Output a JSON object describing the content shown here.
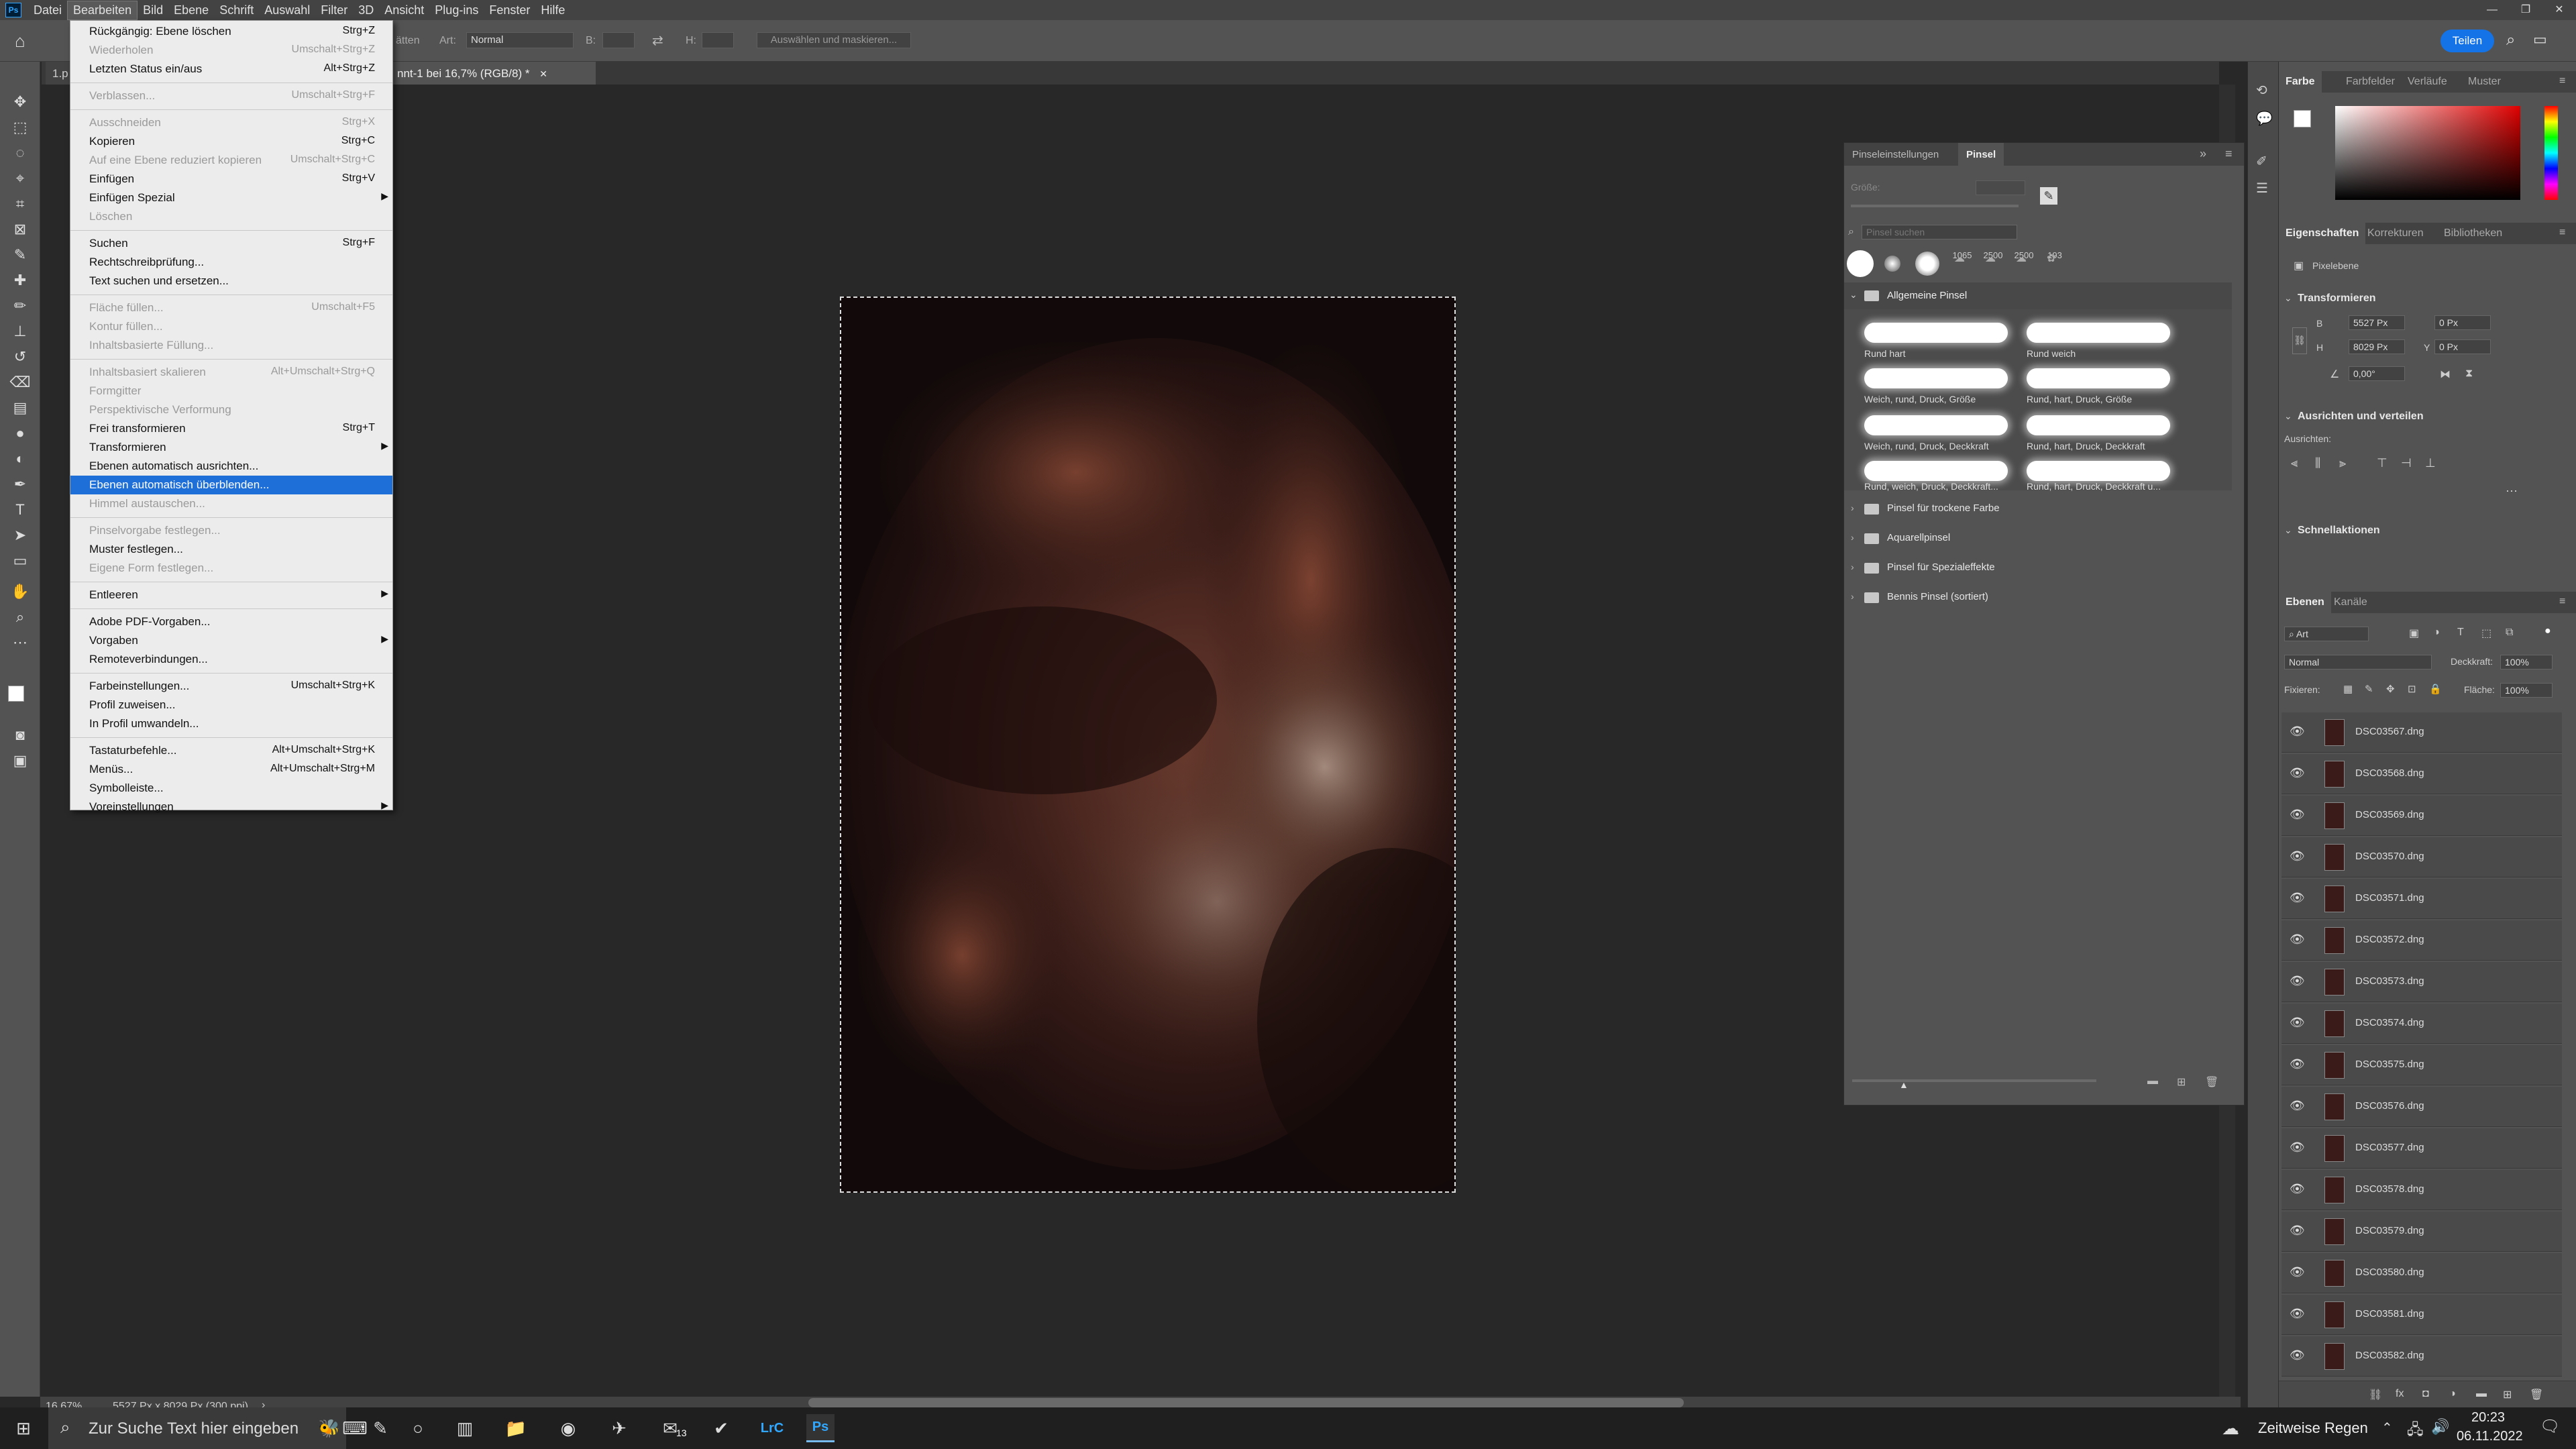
{
  "app": {
    "logo": "Ps"
  },
  "menubar": [
    "Datei",
    "Bearbeiten",
    "Bild",
    "Ebene",
    "Schrift",
    "Auswahl",
    "Filter",
    "3D",
    "Ansicht",
    "Plug-ins",
    "Fenster",
    "Hilfe"
  ],
  "window_controls": [
    "—",
    "❐",
    "✕"
  ],
  "options": {
    "art_label": "Art:",
    "art_value": "Normal",
    "b_label": "B:",
    "h_label": "H:",
    "select_mask": "Auswählen und maskieren...",
    "share": "Teilen",
    "faded_label": "ätten"
  },
  "tabs": [
    {
      "label": "1.p"
    },
    {
      "label": "nnt-1 bei 16,7% (RGB/8) *"
    }
  ],
  "edit_menu": [
    {
      "label": "Rückgängig: Ebene löschen",
      "shortcut": "Strg+Z",
      "disabled": false
    },
    {
      "label": "Wiederholen",
      "shortcut": "Umschalt+Strg+Z",
      "disabled": true
    },
    {
      "label": "Letzten Status ein/aus",
      "shortcut": "Alt+Strg+Z",
      "disabled": false
    },
    {
      "sep": true
    },
    {
      "label": "Verblassen...",
      "shortcut": "Umschalt+Strg+F",
      "disabled": true
    },
    {
      "sep": true
    },
    {
      "label": "Ausschneiden",
      "shortcut": "Strg+X",
      "disabled": true
    },
    {
      "label": "Kopieren",
      "shortcut": "Strg+C",
      "disabled": false
    },
    {
      "label": "Auf eine Ebene reduziert kopieren",
      "shortcut": "Umschalt+Strg+C",
      "disabled": true
    },
    {
      "label": "Einfügen",
      "shortcut": "Strg+V",
      "disabled": false
    },
    {
      "label": "Einfügen Spezial",
      "shortcut": "",
      "submenu": true,
      "disabled": false
    },
    {
      "label": "Löschen",
      "shortcut": "",
      "disabled": true
    },
    {
      "sep": true
    },
    {
      "label": "Suchen",
      "shortcut": "Strg+F",
      "disabled": false
    },
    {
      "label": "Rechtschreibprüfung...",
      "shortcut": "",
      "disabled": false
    },
    {
      "label": "Text suchen und ersetzen...",
      "shortcut": "",
      "disabled": false
    },
    {
      "sep": true
    },
    {
      "label": "Fläche füllen...",
      "shortcut": "Umschalt+F5",
      "disabled": true
    },
    {
      "label": "Kontur füllen...",
      "shortcut": "",
      "disabled": true
    },
    {
      "label": "Inhaltsbasierte Füllung...",
      "shortcut": "",
      "disabled": true
    },
    {
      "sep": true
    },
    {
      "label": "Inhaltsbasiert skalieren",
      "shortcut": "Alt+Umschalt+Strg+Q",
      "disabled": true
    },
    {
      "label": "Formgitter",
      "shortcut": "",
      "disabled": true
    },
    {
      "label": "Perspektivische Verformung",
      "shortcut": "",
      "disabled": true
    },
    {
      "label": "Frei transformieren",
      "shortcut": "Strg+T",
      "disabled": false
    },
    {
      "label": "Transformieren",
      "shortcut": "",
      "submenu": true,
      "disabled": false
    },
    {
      "label": "Ebenen automatisch ausrichten...",
      "shortcut": "",
      "disabled": false
    },
    {
      "label": "Ebenen automatisch überblenden...",
      "shortcut": "",
      "highlight": true,
      "disabled": false
    },
    {
      "label": "Himmel austauschen...",
      "shortcut": "",
      "disabled": true
    },
    {
      "sep": true
    },
    {
      "label": "Pinselvorgabe festlegen...",
      "shortcut": "",
      "disabled": true
    },
    {
      "label": "Muster festlegen...",
      "shortcut": "",
      "disabled": false
    },
    {
      "label": "Eigene Form festlegen...",
      "shortcut": "",
      "disabled": true
    },
    {
      "sep": true
    },
    {
      "label": "Entleeren",
      "shortcut": "",
      "submenu": true,
      "disabled": false
    },
    {
      "sep": true
    },
    {
      "label": "Adobe PDF-Vorgaben...",
      "shortcut": "",
      "disabled": false
    },
    {
      "label": "Vorgaben",
      "shortcut": "",
      "submenu": true,
      "disabled": false
    },
    {
      "label": "Remoteverbindungen...",
      "shortcut": "",
      "disabled": false
    },
    {
      "sep": true
    },
    {
      "label": "Farbeinstellungen...",
      "shortcut": "Umschalt+Strg+K",
      "disabled": false
    },
    {
      "label": "Profil zuweisen...",
      "shortcut": "",
      "disabled": false
    },
    {
      "label": "In Profil umwandeln...",
      "shortcut": "",
      "disabled": false
    },
    {
      "sep": true
    },
    {
      "label": "Tastaturbefehle...",
      "shortcut": "Alt+Umschalt+Strg+K",
      "disabled": false
    },
    {
      "label": "Menüs...",
      "shortcut": "Alt+Umschalt+Strg+M",
      "disabled": false
    },
    {
      "label": "Symbolleiste...",
      "shortcut": "",
      "disabled": false
    },
    {
      "label": "Voreinstellungen",
      "shortcut": "",
      "submenu": true,
      "disabled": false
    }
  ],
  "brush_panel": {
    "tabs": [
      "Pinseleinstellungen",
      "Pinsel"
    ],
    "size_label": "Größe:",
    "search_placeholder": "Pinsel suchen",
    "preset_sizes": [
      "1065",
      "2500",
      "2500",
      "193"
    ],
    "folders_top": "Allgemeine Pinsel",
    "brushes": [
      "Rund hart",
      "Rund weich",
      "Weich, rund, Druck, Größe",
      "Rund, hart, Druck, Größe",
      "Weich, rund, Druck, Deckkraft",
      "Rund, hart, Druck, Deckkraft",
      "Rund, weich, Druck, Deckkraft...",
      "Rund, hart, Druck, Deckkraft u..."
    ],
    "folders": [
      "Pinsel für trockene Farbe",
      "Aquarellpinsel",
      "Pinsel für Spezialeffekte",
      "Bennis Pinsel (sortiert)"
    ]
  },
  "color_panel": {
    "tabs": [
      "Farbe",
      "Farbfelder",
      "Verläufe",
      "Muster"
    ]
  },
  "props_panel": {
    "tabs": [
      "Eigenschaften",
      "Korrekturen",
      "Bibliotheken"
    ],
    "pixel_layer": "Pixelebene",
    "transform_title": "Transformieren",
    "w_label": "B",
    "w_value": "5527 Px",
    "h_label": "H",
    "h_value": "8029 Px",
    "x_label": "X",
    "x_value": "0 Px",
    "y_label": "Y",
    "y_value": "0 Px",
    "angle": "0,00°",
    "align_title": "Ausrichten und verteilen",
    "align_label": "Ausrichten:",
    "quick_title": "Schnellaktionen"
  },
  "layers_panel": {
    "tabs": [
      "Ebenen",
      "Kanäle"
    ],
    "filter_kind": "Art",
    "blend": "Normal",
    "opacity_label": "Deckkraft:",
    "opacity_value": "100%",
    "lock_label": "Fixieren:",
    "fill_label": "Fläche:",
    "fill_value": "100%",
    "layers": [
      "DSC03567.dng",
      "DSC03568.dng",
      "DSC03569.dng",
      "DSC03570.dng",
      "DSC03571.dng",
      "DSC03572.dng",
      "DSC03573.dng",
      "DSC03574.dng",
      "DSC03575.dng",
      "DSC03576.dng",
      "DSC03577.dng",
      "DSC03578.dng",
      "DSC03579.dng",
      "DSC03580.dng",
      "DSC03581.dng",
      "DSC03582.dng"
    ]
  },
  "status": {
    "zoom": "16,67%",
    "info": "5527 Px x 8029 Px (300 ppi)"
  },
  "taskbar": {
    "search_placeholder": "Zur Suche Text hier eingeben",
    "mail_badge": "13",
    "lrc": "LrC",
    "ps": "Ps",
    "weather": "Zeitweise Regen",
    "time": "20:23",
    "date": "06.11.2022"
  }
}
